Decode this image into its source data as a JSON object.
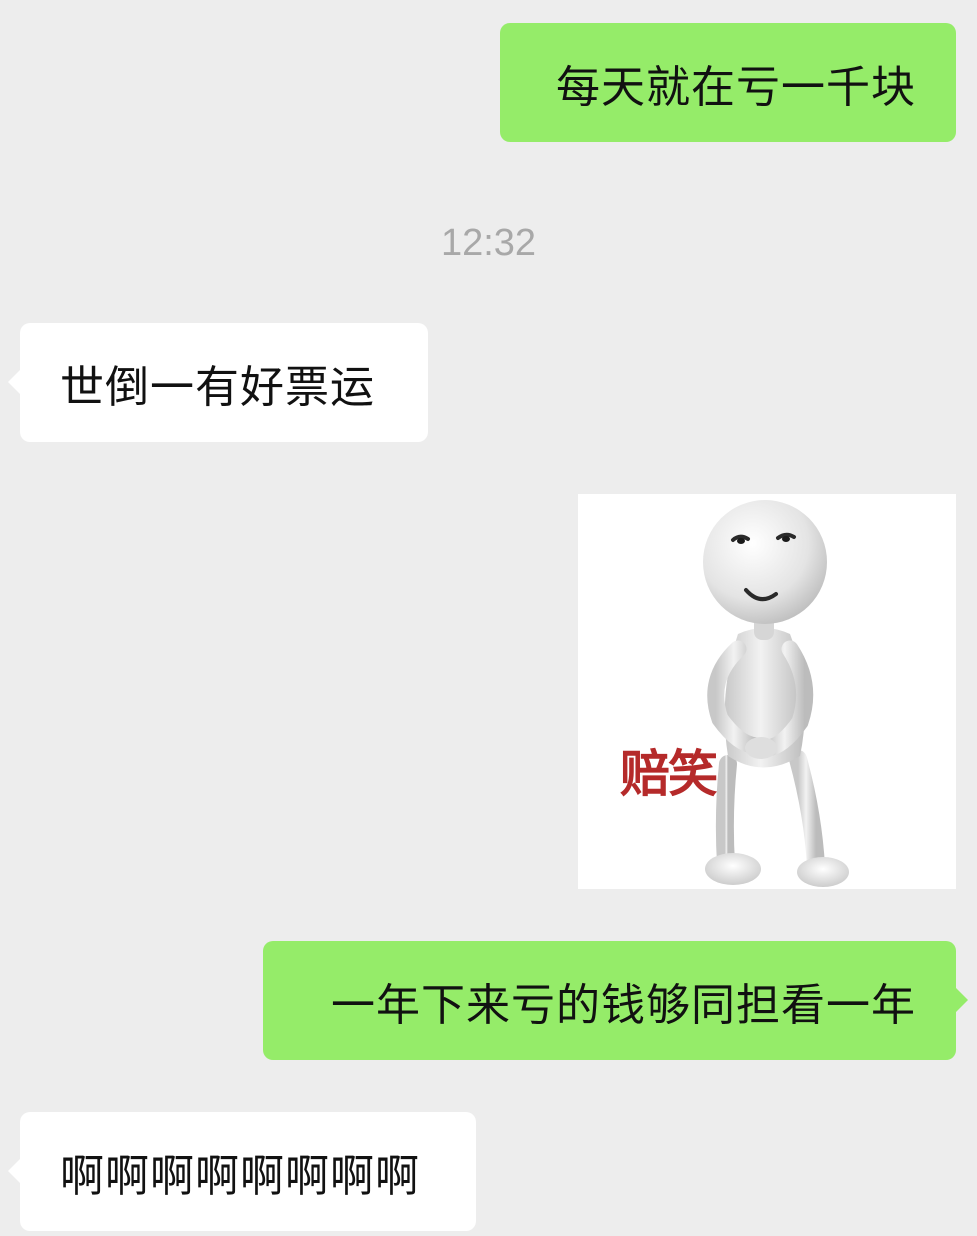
{
  "chat": {
    "messages": [
      {
        "side": "right",
        "type": "text",
        "text": "每天就在亏一千块"
      },
      {
        "type": "timestamp",
        "text": "12:32"
      },
      {
        "side": "left",
        "type": "text",
        "text": "世倒一有好票运"
      },
      {
        "side": "right",
        "type": "sticker",
        "caption": "赔笑"
      },
      {
        "side": "right",
        "type": "text",
        "text": "一年下来亏的钱够同担看一年"
      },
      {
        "side": "left",
        "type": "text",
        "text": "啊啊啊啊啊啊啊啊"
      }
    ]
  },
  "colors": {
    "background": "#ededed",
    "sent_bubble": "#95ec69",
    "received_bubble": "#ffffff",
    "timestamp_text": "#a8a8a8",
    "sticker_caption": "#b52a2a"
  }
}
